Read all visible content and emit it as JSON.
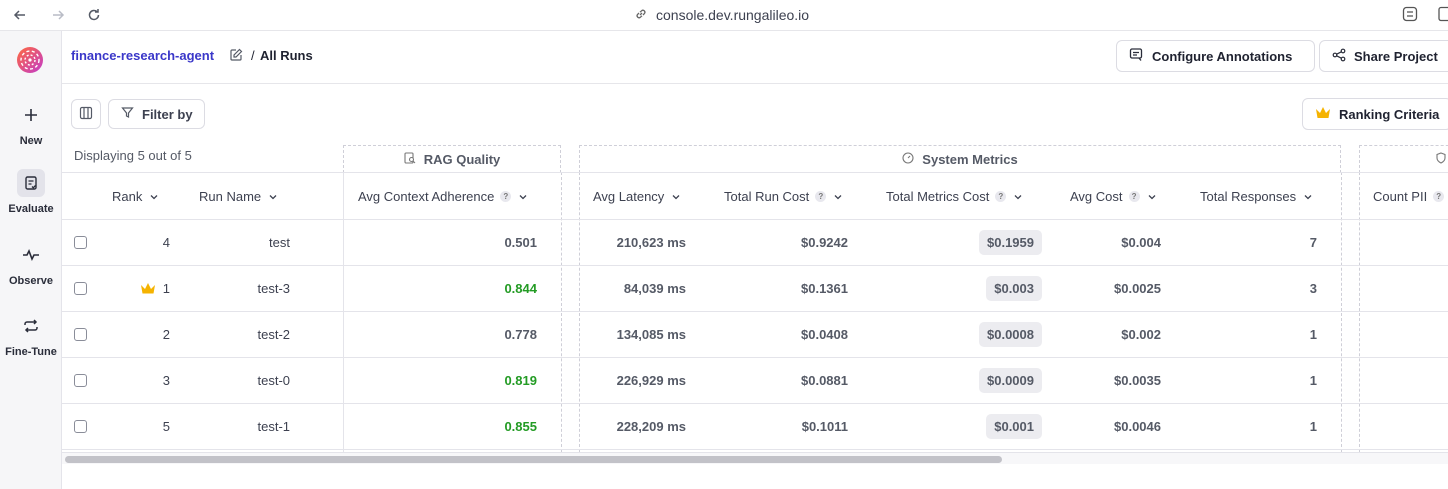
{
  "browser": {
    "url": "console.dev.rungalileo.io"
  },
  "rail": {
    "items": [
      {
        "label": "New",
        "icon": "plus-icon"
      },
      {
        "label": "Evaluate",
        "icon": "clipboard-check-icon"
      },
      {
        "label": "Observe",
        "icon": "activity-icon"
      },
      {
        "label": "Fine-Tune",
        "icon": "repeat-icon"
      }
    ]
  },
  "header": {
    "project": "finance-research-agent",
    "separator": "/",
    "current": "All Runs",
    "configure_label": "Configure Annotations",
    "share_label": "Share Project"
  },
  "toolbar": {
    "filter_label": "Filter by",
    "ranking_label": "Ranking Criteria",
    "displaying": "Displaying 5 out of 5"
  },
  "groups": {
    "rag": "RAG Quality",
    "system": "System Metrics"
  },
  "columns": {
    "rank": "Rank",
    "run_name": "Run Name",
    "context": "Avg Context Adherence",
    "latency": "Avg Latency",
    "run_cost": "Total Run Cost",
    "metrics_cost": "Total Metrics Cost",
    "avg_cost": "Avg Cost",
    "responses": "Total Responses",
    "pii": "Count PII"
  },
  "rows": [
    {
      "rank": "4",
      "name": "test",
      "context": "0.501",
      "context_good": false,
      "latency": "210,623 ms",
      "run_cost": "$0.9242",
      "metrics_cost": "$0.1959",
      "avg_cost": "$0.004",
      "responses": "7",
      "top": false
    },
    {
      "rank": "1",
      "name": "test-3",
      "context": "0.844",
      "context_good": true,
      "latency": "84,039 ms",
      "run_cost": "$0.1361",
      "metrics_cost": "$0.003",
      "avg_cost": "$0.0025",
      "responses": "3",
      "top": true
    },
    {
      "rank": "2",
      "name": "test-2",
      "context": "0.778",
      "context_good": false,
      "latency": "134,085 ms",
      "run_cost": "$0.0408",
      "metrics_cost": "$0.0008",
      "avg_cost": "$0.002",
      "responses": "1",
      "top": false
    },
    {
      "rank": "3",
      "name": "test-0",
      "context": "0.819",
      "context_good": true,
      "latency": "226,929 ms",
      "run_cost": "$0.0881",
      "metrics_cost": "$0.0009",
      "avg_cost": "$0.0035",
      "responses": "1",
      "top": false
    },
    {
      "rank": "5",
      "name": "test-1",
      "context": "0.855",
      "context_good": true,
      "latency": "228,209 ms",
      "run_cost": "$0.1011",
      "metrics_cost": "$0.001",
      "avg_cost": "$0.0046",
      "responses": "1",
      "top": false
    }
  ],
  "colors": {
    "brand": "#3a37c9",
    "good": "#239b24",
    "crown": "#f5b301"
  }
}
